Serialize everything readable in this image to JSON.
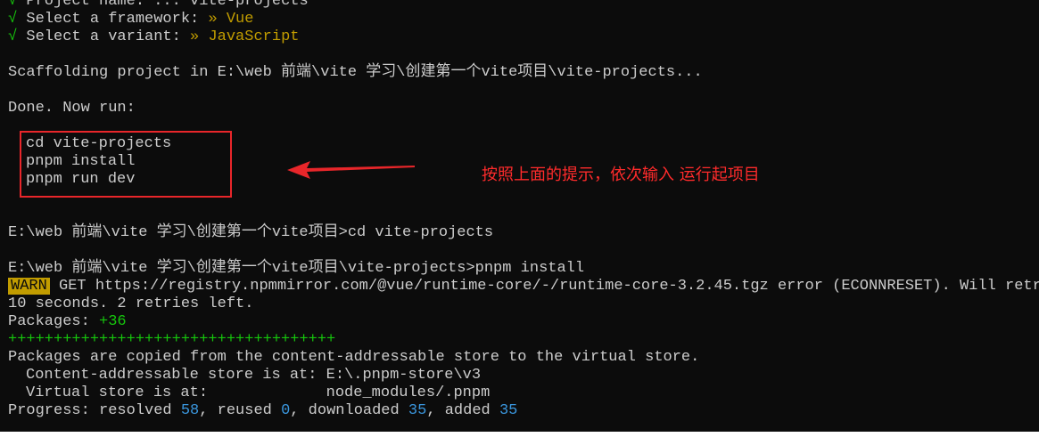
{
  "terminal": {
    "prompt_lines": [
      {
        "check": "√",
        "label": " Project name: ... ",
        "value": "vite-projects"
      },
      {
        "check": "√",
        "label": " Select a framework: ",
        "value": "» Vue"
      },
      {
        "check": "√",
        "label": " Select a variant: ",
        "value": "» JavaScript"
      }
    ],
    "scaffolding": "Scaffolding project in E:\\web 前端\\vite 学习\\创建第一个vite项目\\vite-projects...",
    "done": "Done. Now run:",
    "commands": [
      "cd vite-projects",
      "pnpm install",
      "pnpm run dev"
    ],
    "cmd1": "E:\\web 前端\\vite 学习\\创建第一个vite项目>cd vite-projects",
    "cmd2": "E:\\web 前端\\vite 学习\\创建第一个vite项目\\vite-projects>pnpm install",
    "warn_badge": "WARN",
    "warn_text": " GET https://registry.npmmirror.com/@vue/runtime-core/-/runtime-core-3.2.45.tgz error (ECONNRESET). Will retry in",
    "warn_cont": "10 seconds. 2 retries left.",
    "packages_label": "Packages: ",
    "packages_count": "+36",
    "progress_bar": "++++++++++++++++++++++++++++++++++++",
    "copied": "Packages are copied from the content-addressable store to the virtual store.",
    "cas_store": "Content-addressable store is at: E:\\.pnpm-store\\v3",
    "virtual_store": "Virtual store is at:             node_modules/.pnpm",
    "progress": {
      "label": "Progress: resolved ",
      "resolved": "58",
      "reused_label": ", reused ",
      "reused": "0",
      "downloaded_label": ", downloaded ",
      "downloaded": "35",
      "added_label": ", added ",
      "added": "35"
    }
  },
  "annotation": {
    "text": "按照上面的提示，依次输入 运行起项目",
    "color": "#ff2b2b"
  },
  "colors": {
    "background": "#0c0c0c",
    "foreground": "#cccccc",
    "green": "#16c60c",
    "yellow": "#c19c00",
    "blue": "#3a96dd",
    "callout_red": "#e8262a"
  }
}
